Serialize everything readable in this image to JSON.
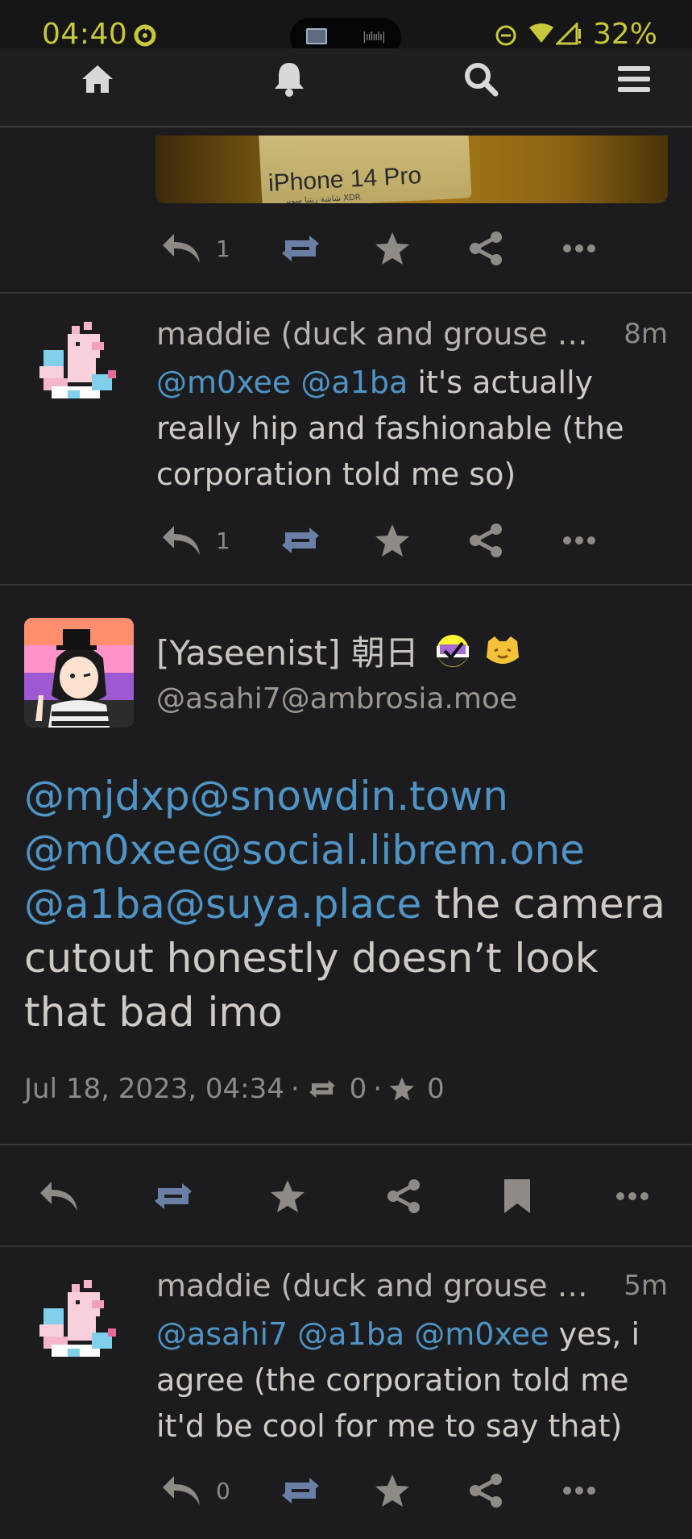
{
  "status_bar": {
    "time": "04:40",
    "battery": "32%"
  },
  "nav": {
    "items": [
      "home-icon",
      "bell-icon",
      "search-icon",
      "menu-icon"
    ]
  },
  "photo": {
    "text": "iPhone 14 Pro",
    "small_text": "شاشة ريتنا سوبر XDR"
  },
  "post1_actions": {
    "reply_count": "1"
  },
  "post2": {
    "author": "maddie (duck and grouse s…",
    "time": "8m",
    "mentions": [
      "@m0xee",
      "@a1ba"
    ],
    "text": " it's actually really hip and fashionable (the corporation told me so)",
    "reply_count": "1"
  },
  "focus": {
    "name": "[Yaseenist] 朝日",
    "handle": "@asahi7@ambrosia.moe",
    "mentions": [
      "@mjdxp@snowdin.town",
      "@m0xee@social.librem.one",
      "@a1ba@suya.place"
    ],
    "text": " the camera cutout honestly doesn’t look that bad imo",
    "date": "Jul 18, 2023, 04:34",
    "boosts": "0",
    "favs": "0"
  },
  "post3": {
    "author": "maddie (duck and grouse s…",
    "time": "5m",
    "mentions": [
      "@asahi7",
      "@a1ba",
      "@m0xee"
    ],
    "text": " yes, i agree (the corporation told me it'd be cool for me to say that)",
    "reply_count": "0"
  },
  "colors": {
    "accent_status": "#c7c83a",
    "mention": "#4f94c4",
    "icon": "#8e8a86",
    "boost": "#6b7fa6"
  }
}
